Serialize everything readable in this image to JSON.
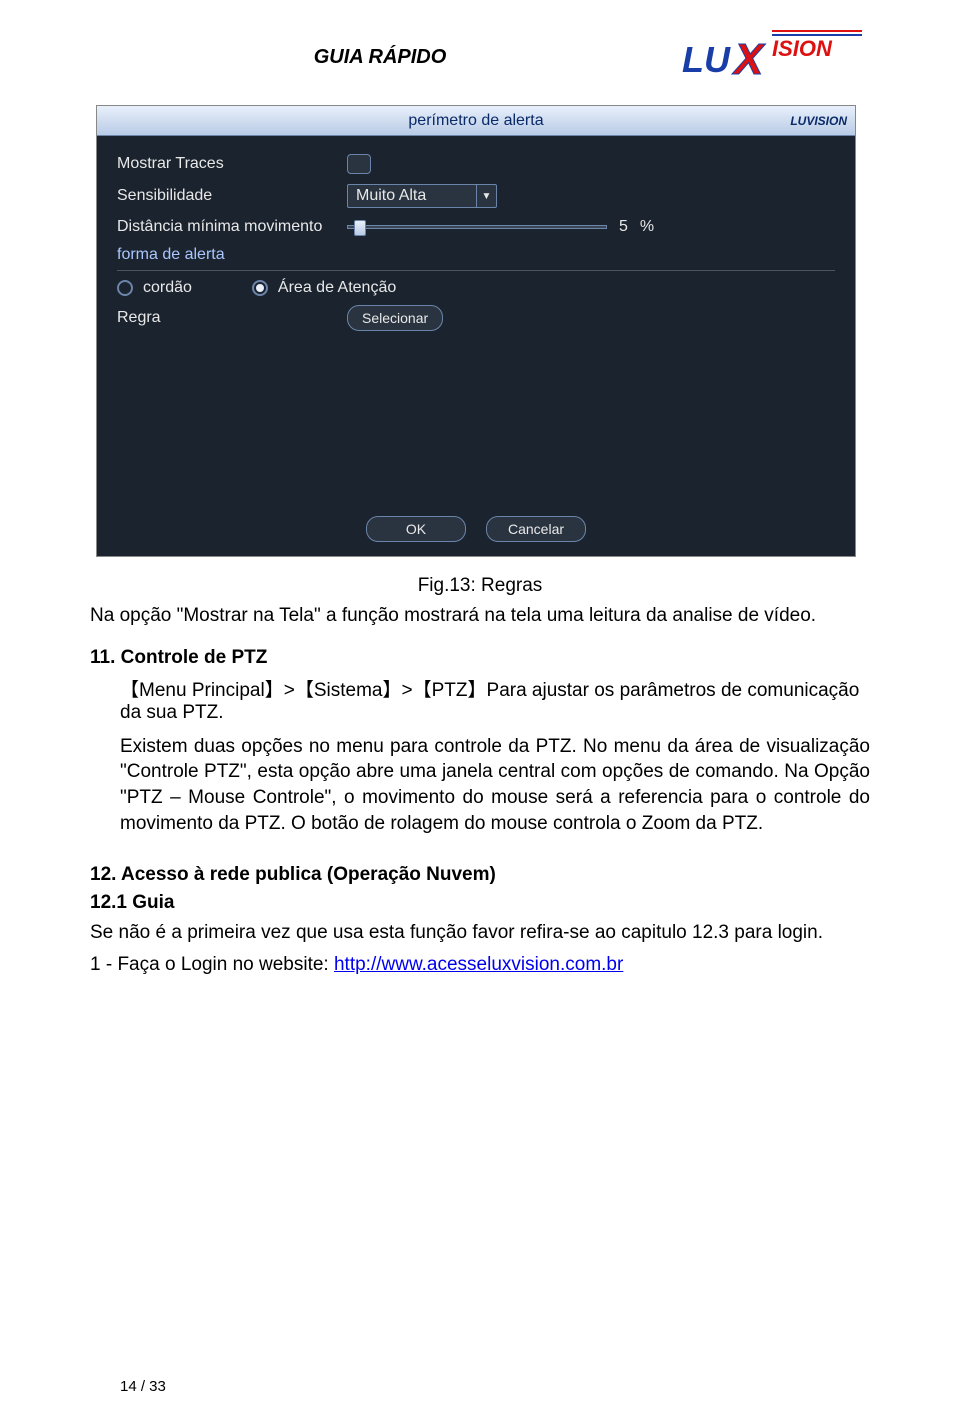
{
  "header": {
    "title": "GUIA RÁPIDO",
    "logo_lux": "LUX",
    "logo_v": "V",
    "logo_ision": "ISION"
  },
  "dvr": {
    "title": "perímetro de alerta",
    "brand": "LUVISION",
    "labels": {
      "traces": "Mostrar Traces",
      "sensitivity": "Sensibilidade",
      "min_dist": "Distância mínima movimento",
      "alert_form": "forma de alerta",
      "rule": "Regra"
    },
    "sensitivity_value": "Muito Alta",
    "slider_value": "5",
    "slider_unit": "%",
    "radio_cord": "cordão",
    "radio_area": "Área de Atenção",
    "select_button": "Selecionar",
    "ok": "OK",
    "cancel": "Cancelar"
  },
  "caption": "Fig.13: Regras",
  "para1": "Na opção \"Mostrar na Tela\" a função mostrará na tela uma leitura da analise de vídeo.",
  "section11_title": "11. Controle de PTZ",
  "breadcrumb": {
    "menu": "Menu Principal",
    "sistema": "Sistema",
    "ptz": "PTZ",
    "tail": "Para ajustar os parâmetros de comunicação da sua PTZ."
  },
  "para2": "Existem duas opções no menu para controle da PTZ. No menu da área de visualização \"Controle PTZ\", esta opção abre uma janela central com opções de comando. Na Opção \"PTZ – Mouse Controle\", o movimento do mouse será a referencia para o controle do movimento da PTZ. O botão de rolagem do mouse controla o Zoom da PTZ.",
  "section12_title": "12. Acesso à rede publica (Operação Nuvem)",
  "section12_1": "12.1 Guia",
  "para3": "Se não é a primeira vez que usa esta função favor refira-se ao capitulo 12.3 para login.",
  "login_prefix": "1 - Faça o Login no website: ",
  "login_link": "http://www.acesseluxvision.com.br",
  "page_number": "14 / 33"
}
